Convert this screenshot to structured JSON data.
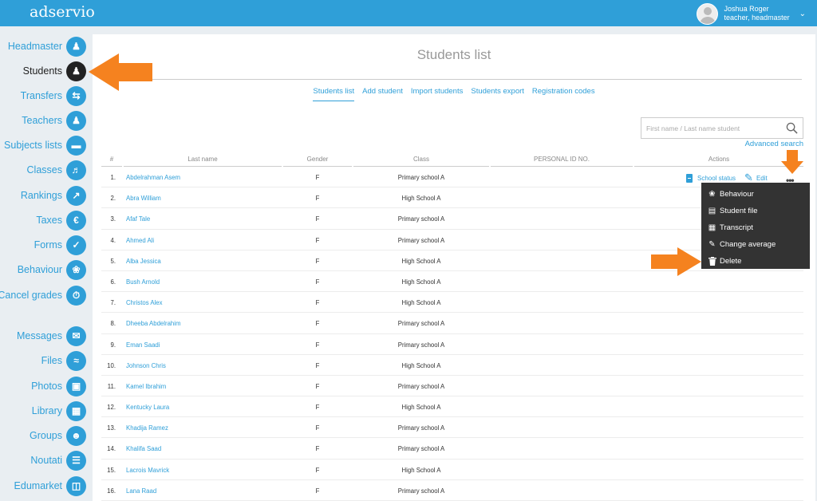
{
  "app": {
    "logo": "adservio",
    "user": {
      "name": "Joshua Roger",
      "role": "teacher, headmaster"
    }
  },
  "sidebar": {
    "items": [
      {
        "label": "Headmaster",
        "icon": "headmaster-icon",
        "active": false
      },
      {
        "label": "Students",
        "icon": "student-icon",
        "active": true
      },
      {
        "label": "Transfers",
        "icon": "transfer-icon",
        "active": false
      },
      {
        "label": "Teachers",
        "icon": "teacher-icon",
        "active": false
      },
      {
        "label": "Subjects lists",
        "icon": "subjects-icon",
        "active": false
      },
      {
        "label": "Classes",
        "icon": "classes-icon",
        "active": false
      },
      {
        "label": "Rankings",
        "icon": "rankings-icon",
        "active": false
      },
      {
        "label": "Taxes",
        "icon": "euro-icon",
        "active": false
      },
      {
        "label": "Forms",
        "icon": "forms-icon",
        "active": false
      },
      {
        "label": "Behaviour",
        "icon": "medal-icon",
        "active": false
      },
      {
        "label": "Cancel grades",
        "icon": "cancel-grades-icon",
        "active": false
      },
      {
        "label": "Messages",
        "icon": "envelope-icon",
        "active": false
      },
      {
        "label": "Files",
        "icon": "paperclip-icon",
        "active": false
      },
      {
        "label": "Photos",
        "icon": "photos-icon",
        "active": false
      },
      {
        "label": "Library",
        "icon": "library-icon",
        "active": false
      },
      {
        "label": "Groups",
        "icon": "groups-icon",
        "active": false
      },
      {
        "label": "Noutati",
        "icon": "news-icon",
        "active": false
      },
      {
        "label": "Edumarket",
        "icon": "cart-icon",
        "active": false
      }
    ]
  },
  "main": {
    "title": "Students list",
    "tabs": [
      {
        "label": "Students list",
        "active": true
      },
      {
        "label": "Add student",
        "active": false
      },
      {
        "label": "Import students",
        "active": false
      },
      {
        "label": "Students export",
        "active": false
      },
      {
        "label": "Registration codes",
        "active": false
      }
    ],
    "search": {
      "placeholder": "First name / Last name student",
      "value": ""
    },
    "advanced_search": "Advanced search",
    "table": {
      "headers": {
        "num": "#",
        "last_name": "Last name",
        "gender": "Gender",
        "class": "Class",
        "personal_id": "PERSONAL ID NO.",
        "actions": "Actions"
      },
      "rows": [
        {
          "num": "1.",
          "name": "Abdelrahman Asem",
          "gender": "F",
          "class": "Primary school A"
        },
        {
          "num": "2.",
          "name": "Abra William",
          "gender": "F",
          "class": "High School A"
        },
        {
          "num": "3.",
          "name": "Afaf Tale",
          "gender": "F",
          "class": "Primary school A"
        },
        {
          "num": "4.",
          "name": "Ahmed Ali",
          "gender": "F",
          "class": "Primary school A"
        },
        {
          "num": "5.",
          "name": "Alba Jessica",
          "gender": "F",
          "class": "High School A"
        },
        {
          "num": "6.",
          "name": "Bush Arnold",
          "gender": "F",
          "class": "High School A"
        },
        {
          "num": "7.",
          "name": "Christos Alex",
          "gender": "F",
          "class": "High School A"
        },
        {
          "num": "8.",
          "name": "Dheeba Abdelrahim",
          "gender": "F",
          "class": "Primary school A"
        },
        {
          "num": "9.",
          "name": "Eman Saadi",
          "gender": "F",
          "class": "Primary school A"
        },
        {
          "num": "10.",
          "name": "Johnson Chris",
          "gender": "F",
          "class": "High School A"
        },
        {
          "num": "11.",
          "name": "Kamel Ibrahim",
          "gender": "F",
          "class": "Primary school A"
        },
        {
          "num": "12.",
          "name": "Kentucky Laura",
          "gender": "F",
          "class": "High School A"
        },
        {
          "num": "13.",
          "name": "Khadija Ramez",
          "gender": "F",
          "class": "Primary school A"
        },
        {
          "num": "14.",
          "name": "Khalifa Saad",
          "gender": "F",
          "class": "Primary school A"
        },
        {
          "num": "15.",
          "name": "Lacrois Mavrick",
          "gender": "F",
          "class": "High School A"
        },
        {
          "num": "16.",
          "name": "Lana Raad",
          "gender": "F",
          "class": "Primary school A"
        }
      ]
    },
    "row_actions": {
      "school_status": "School status",
      "edit": "Edit"
    },
    "dropdown": [
      {
        "label": "Behaviour",
        "icon": "medal-icon"
      },
      {
        "label": "Student file",
        "icon": "file-icon"
      },
      {
        "label": "Transcript",
        "icon": "transcript-icon"
      },
      {
        "label": "Change average",
        "icon": "change-average-icon"
      },
      {
        "label": "Delete",
        "icon": "trash-icon"
      }
    ]
  },
  "colors": {
    "accent": "#2f9fd8",
    "arrow": "#f5821f",
    "menu_bg": "#333333"
  }
}
